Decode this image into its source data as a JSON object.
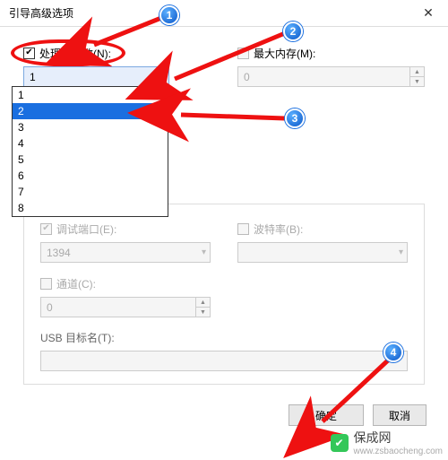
{
  "window": {
    "title": "引导高级选项",
    "close_glyph": "✕"
  },
  "top": {
    "proc_label": "处理器个数(N):",
    "proc_checked_glyph": "✔",
    "proc_value": "1",
    "mem_label": "最大内存(M):",
    "mem_value": "0"
  },
  "dropdown_options": [
    "1",
    "2",
    "3",
    "4",
    "5",
    "6",
    "7",
    "8"
  ],
  "dropdown_selected_index": 1,
  "group": {
    "debug_port_label": "调试端口(E):",
    "debug_port_value": "1394",
    "baud_label": "波特率(B):",
    "baud_value": "",
    "channel_label": "通道(C):",
    "channel_value": "0",
    "usb_label": "USB 目标名(T):",
    "usb_value": ""
  },
  "buttons": {
    "ok": "确定",
    "cancel": "取消"
  },
  "annotations": {
    "b1": "1",
    "b2": "2",
    "b3": "3",
    "b4": "4"
  },
  "watermark": {
    "name": "保成网",
    "url": "www.zsbaocheng.com",
    "logo_glyph": "✔"
  }
}
